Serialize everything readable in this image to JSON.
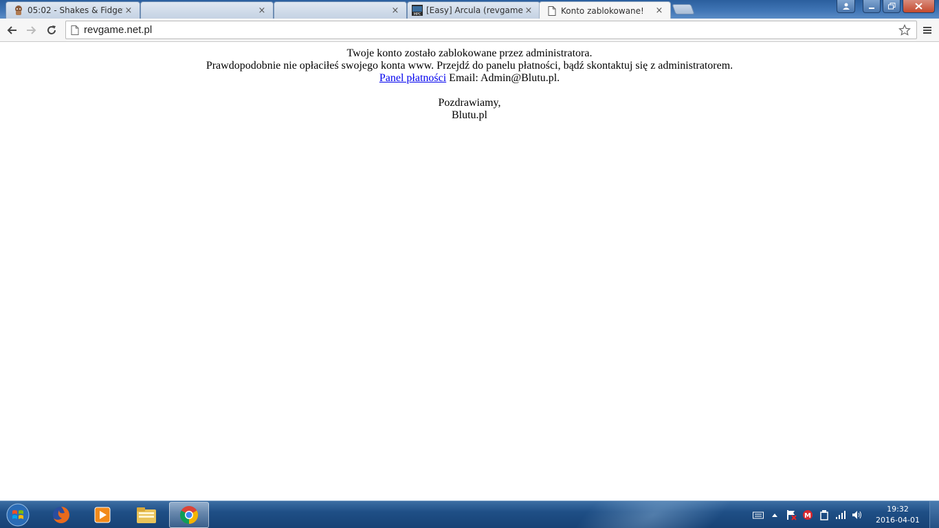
{
  "browser": {
    "tabs": [
      {
        "title": "05:02 - Shakes & Fidget",
        "icon": "shakes-fidget-favicon",
        "active": false
      },
      {
        "title": "",
        "icon": "",
        "active": false
      },
      {
        "title": "",
        "icon": "",
        "active": false
      },
      {
        "title": "[Easy] Arcula (revgame.net",
        "icon": "mpc-favicon",
        "active": false
      },
      {
        "title": "Konto zablokowane!",
        "icon": "page-icon",
        "active": true
      }
    ],
    "tab_close_glyph": "×",
    "url": "revgame.net.pl"
  },
  "page": {
    "line1": "Twoje konto zostało zablokowane przez administratora.",
    "line2": "Prawdopodobnie nie opłaciłeś swojego konta www. Przejdź do panelu płatności, bądź skontaktuj się z administratorem.",
    "link_text": "Panel płatności",
    "email_text": " Email: Admin@Blutu.pl.",
    "greeting": "Pozdrawiamy,",
    "signature": "Blutu.pl"
  },
  "taskbar": {
    "apps": [
      "firefox-icon",
      "media-player-icon",
      "file-explorer-icon",
      "chrome-icon"
    ],
    "active_app": "chrome-icon",
    "clock_time": "19:32",
    "clock_date": "2016-04-01"
  },
  "colors": {
    "link": "#0000ee",
    "tabstrip": "#3f74b4",
    "taskbar": "#1f4f86"
  }
}
